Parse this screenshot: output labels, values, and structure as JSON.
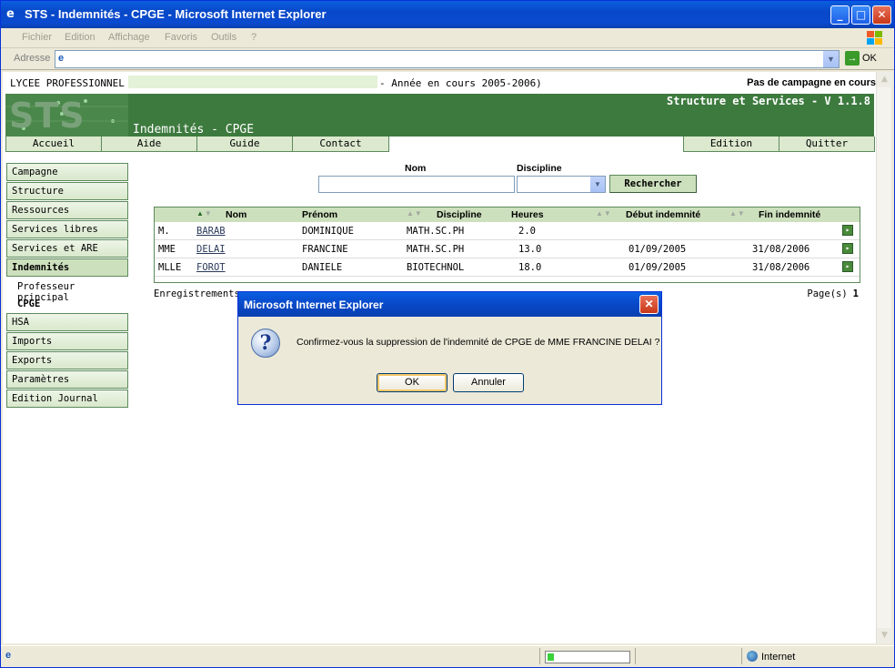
{
  "window": {
    "title": "STS - Indemnités - CPGE - Microsoft Internet Explorer",
    "minimize_glyph": "_",
    "maximize_glyph": "□",
    "close_glyph": "✕"
  },
  "menubar": {
    "items": [
      "Fichier",
      "Edition",
      "Affichage",
      "Favoris",
      "Outils",
      "?"
    ]
  },
  "addressbar": {
    "label": "Adresse",
    "go_label": "OK",
    "go_arrow": "→"
  },
  "page": {
    "school": "LYCEE PROFESSIONNEL",
    "year": "- Année en cours 2005-2006)",
    "campaign": "Pas de campagne en cours",
    "logo": "STS",
    "app_name": "Structure et Services - V 1.1.8",
    "title": "Indemnités - CPGE",
    "topnav_left": [
      "Accueil",
      "Aide",
      "Guide",
      "Contact"
    ],
    "topnav_right": [
      "Edition",
      "Quitter"
    ],
    "sidebar": {
      "items_top": [
        "Campagne",
        "Structure",
        "Ressources",
        "Services libres",
        "Services et ARE",
        "Indemnités"
      ],
      "subitems": [
        "Professeur principal",
        "CPGE"
      ],
      "items_bottom": [
        "HSA",
        "Imports",
        "Exports",
        "Paramètres",
        "Edition Journal"
      ]
    },
    "search": {
      "nom_label": "Nom",
      "discipline_label": "Discipline",
      "button": "Rechercher",
      "dropdown_glyph": "▼"
    },
    "grid": {
      "headers": [
        "Nom",
        "Prénom",
        "Discipline",
        "Heures",
        "Début indemnité",
        "Fin indemnité"
      ],
      "rows": [
        {
          "civ": "M.",
          "nom": "BARAB",
          "prenom": "DOMINIQUE",
          "discipline": "MATH.SC.PH",
          "heures": "2.0",
          "debut": "",
          "fin": ""
        },
        {
          "civ": "MME",
          "nom": "DELAI",
          "prenom": "FRANCINE",
          "discipline": "MATH.SC.PH",
          "heures": "13.0",
          "debut": "01/09/2005",
          "fin": "31/08/2006"
        },
        {
          "civ": "MLLE",
          "nom": "FOROT",
          "prenom": "DANIELE",
          "discipline": "BIOTECHNOL",
          "heures": "18.0",
          "debut": "01/09/2005",
          "fin": "31/08/2006"
        }
      ],
      "row_button_glyph": "▸"
    },
    "footer": {
      "records": "Enregistrements",
      "pages_label": "Page(s)",
      "pages_value": "1"
    }
  },
  "dialog": {
    "title": "Microsoft Internet Explorer",
    "close_glyph": "✕",
    "icon": "?",
    "message": "Confirmez-vous la suppression de l'indemnité de CPGE de MME FRANCINE DELAI ?",
    "ok": "OK",
    "cancel": "Annuler"
  },
  "statusbar": {
    "zone": "Internet",
    "progress": 0.08
  },
  "colors": {
    "accent_green": "#3d7a3e",
    "tab_green": "#dce9cf",
    "xp_blue": "#0848c8"
  }
}
